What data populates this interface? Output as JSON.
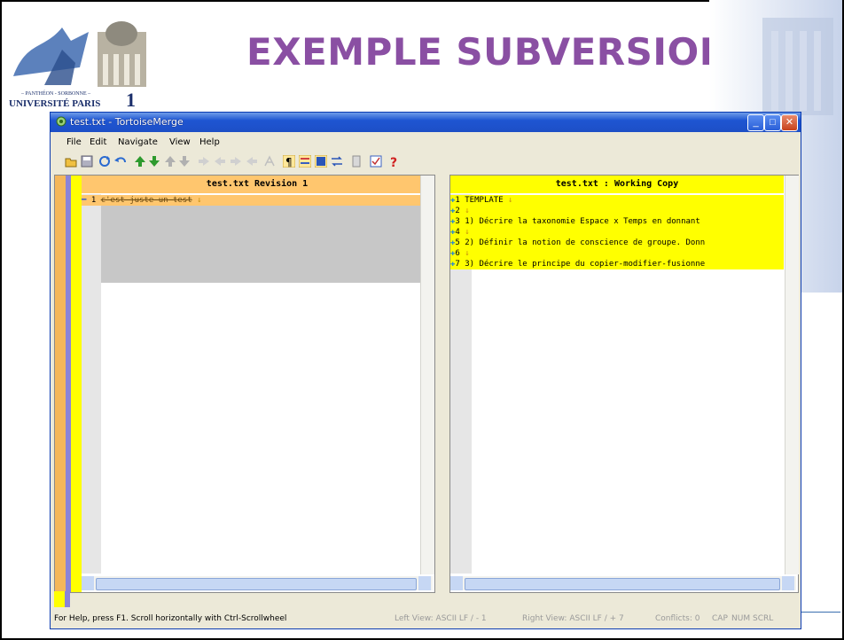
{
  "slide": {
    "title": "EXEMPLE SUBVERSION",
    "logo_text": "UNIVERSITÉ PARIS 1",
    "logo_sub": "PANTHÉON - SORBONNE",
    "logo_big": "1"
  },
  "window": {
    "title": "test.txt - TortoiseMerge",
    "minimize": "_",
    "maximize": "□",
    "close": "✕"
  },
  "menu": [
    "File",
    "Edit",
    "Navigate",
    "View",
    "Help"
  ],
  "toolbar_icons": [
    "open-icon",
    "save-icon",
    "reload-icon",
    "undo-icon",
    "next-diff-icon",
    "prev-diff-icon",
    "next-conflict-icon",
    "prev-conflict-icon",
    "use-left-icon",
    "use-right-icon",
    "use-left-first-icon",
    "use-right-first-icon",
    "mark-resolved-icon",
    "whitespace-icon",
    "inline-diff-icon",
    "one-pane-icon",
    "switch-icon",
    "line-diff-icon",
    "patch-icon",
    "help-icon"
  ],
  "left_pane": {
    "header": "test.txt Revision 1",
    "lines": [
      {
        "num": "1",
        "text": "c'est juste un test"
      }
    ]
  },
  "right_pane": {
    "header": "test.txt : Working Copy",
    "lines": [
      {
        "num": "1",
        "text": "TEMPLATE"
      },
      {
        "num": "2",
        "text": ""
      },
      {
        "num": "3",
        "text": "1) Décrire la taxonomie Espace x Temps en donnant"
      },
      {
        "num": "4",
        "text": ""
      },
      {
        "num": "5",
        "text": "2) Définir la notion de conscience de groupe. Donn"
      },
      {
        "num": "6",
        "text": ""
      },
      {
        "num": "7",
        "text": "3) Décrire le principe du copier-modifier-fusionne"
      }
    ]
  },
  "status": {
    "help": "For Help, press F1. Scroll horizontally with Ctrl-Scrollwheel",
    "left_view": "Left View: ASCII LF  / - 1",
    "right_view": "Right View: ASCII LF  / + 7",
    "conflicts": "Conflicts: 0",
    "cap": "CAP",
    "num": "NUM",
    "scrl": "SCRL"
  },
  "colors": {
    "title_purple": "#8a4fa3",
    "removed_bg": "#ffc66e",
    "added_bg": "#ffff00",
    "diff_blue": "#9090f0"
  }
}
